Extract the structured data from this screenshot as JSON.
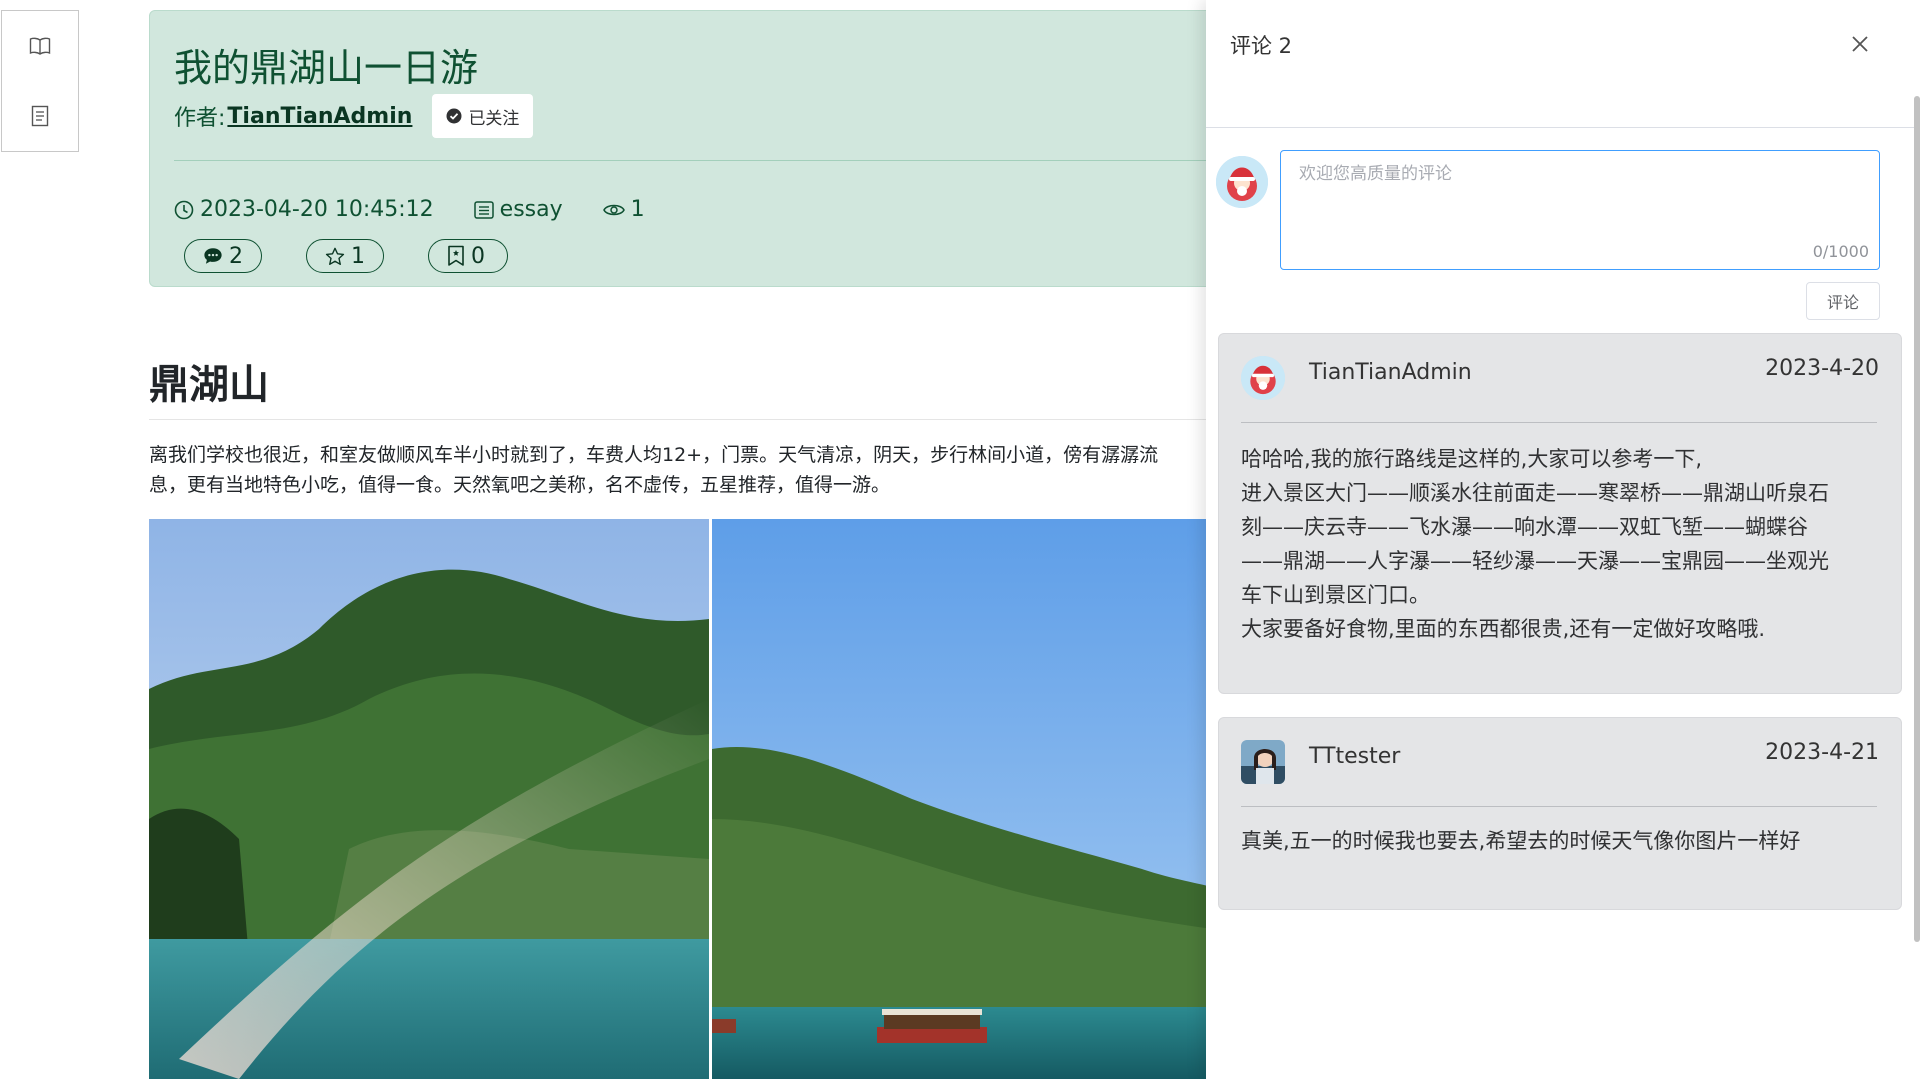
{
  "toolbar": {
    "icons": [
      "book-open-icon",
      "document-icon"
    ]
  },
  "article": {
    "title": "我的鼎湖山一日游",
    "author_label": "作者:",
    "author_name": "TianTianAdmin",
    "follow_label": "已关注",
    "datetime": "2023-04-20 10:45:12",
    "category": "essay",
    "views": "1",
    "comments_count": "2",
    "stars_count": "1",
    "bookmarks_count": "0",
    "section_heading": "鼎湖山",
    "paragraph_lines": [
      "离我们学校也很近，和室友做顺风车半小时就到了，车费人均12+，门票。天气清凉，阴天，步行林间小道，傍有潺潺流",
      "息，更有当地特色小吃，值得一食。天然氧吧之美称，名不虚传，五星推荐，值得一游。"
    ]
  },
  "drawer": {
    "title": "评论 2",
    "input": {
      "placeholder": "欢迎您高质量的评论",
      "value": "",
      "counter": "0/1000"
    },
    "submit_label": "评论",
    "comments": [
      {
        "user": "TianTianAdmin",
        "date": "2023-4-20",
        "lines": [
          "哈哈哈,我的旅行路线是这样的,大家可以参考一下,",
          "进入景区大门——顺溪水往前面走——寒翠桥——鼎湖山听泉石",
          "刻——庆云寺——飞水瀑——响水潭——双虹飞堑——蝴蝶谷",
          "——鼎湖——人字瀑——轻纱瀑——天瀑——宝鼎园——坐观光",
          "车下山到景区门口。",
          "大家要备好食物,里面的东西都很贵,还有一定做好攻略哦."
        ]
      },
      {
        "user": "TTtester",
        "date": "2023-4-21",
        "text": "真美,五一的时候我也要去,希望去的时候天气像你图片一样好"
      }
    ]
  },
  "colors": {
    "header_bg": "#d1e7dd",
    "header_text": "#0f5132",
    "input_border": "#409eff",
    "card_bg": "#e4e5e7"
  }
}
